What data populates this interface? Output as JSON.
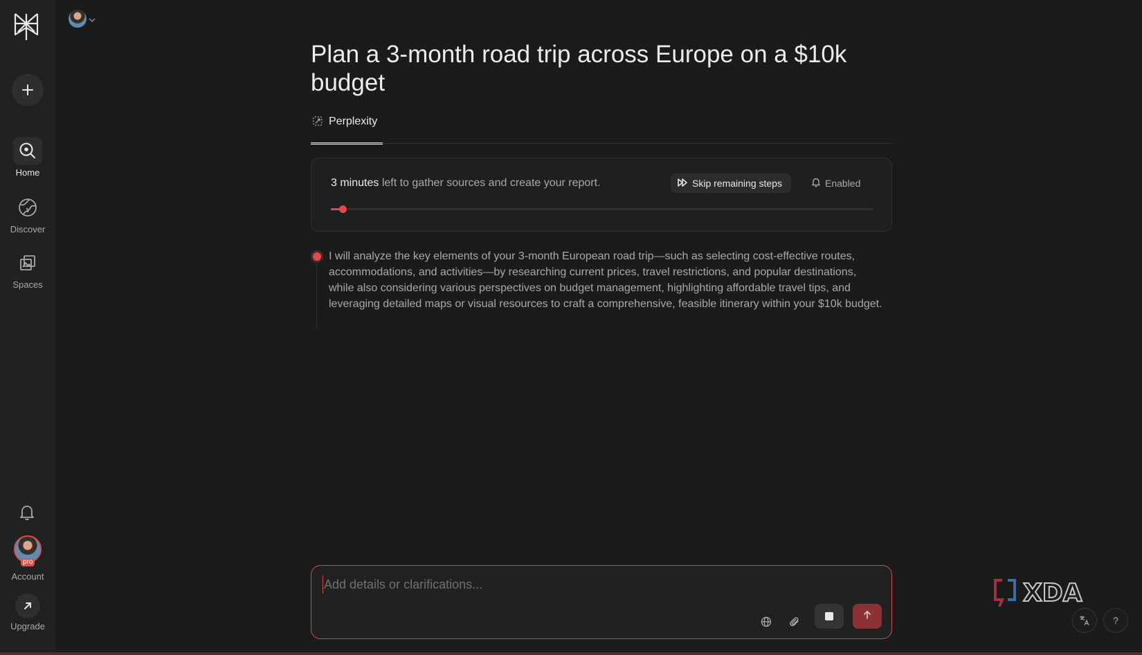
{
  "sidebar": {
    "items": [
      {
        "label": "Home",
        "icon": "home-search-icon"
      },
      {
        "label": "Discover",
        "icon": "globe-icon"
      },
      {
        "label": "Spaces",
        "icon": "spaces-icon"
      }
    ],
    "account_label": "Account",
    "pro_badge": "pro",
    "upgrade_label": "Upgrade"
  },
  "thread": {
    "title": "Plan a 3-month road trip across Europe on a $10k budget",
    "tab_label": "Perplexity"
  },
  "progress": {
    "time_strong": "3 minutes",
    "time_rest": " left to gather sources and create your report.",
    "skip_label": "Skip remaining steps",
    "notify_label": "Enabled",
    "fraction": 0.022
  },
  "step": {
    "text": "I will analyze the key elements of your 3-month European road trip—such as selecting cost-effective routes, accommodations, and activities—by researching current prices, travel restrictions, and popular destinations, while also considering various perspectives on budget management, highlighting affordable travel tips, and leveraging detailed maps or visual resources to craft a comprehensive, feasible itinerary within your $10k budget."
  },
  "composer": {
    "placeholder": "Add details or clarifications...",
    "value": ""
  },
  "watermark": "XDA",
  "help_label": "?",
  "colors": {
    "accent": "#e04a4a",
    "background": "#1a1c1c",
    "sidebar": "#202222"
  }
}
